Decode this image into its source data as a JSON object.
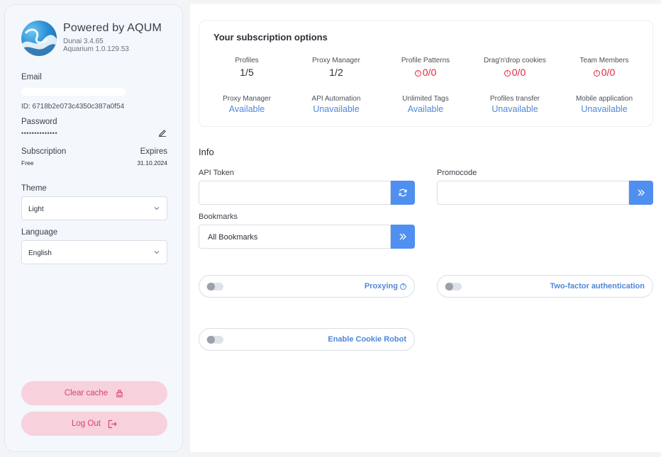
{
  "brand": {
    "powered_by": "Powered by AQUM",
    "version_dunai": "Dunai 3.4.65",
    "version_aquarium": "Aquarium 1.0.129.53"
  },
  "account": {
    "email_label": "Email",
    "id_text": "ID: 6718b2e073c4350c387a0f54",
    "password_label": "Password",
    "password_value": "••••••••••••••",
    "subscription_label": "Subscription",
    "subscription_value": "Free",
    "expires_label": "Expires",
    "expires_value": "31.10.2024",
    "theme_label": "Theme",
    "theme_value": "Light",
    "language_label": "Language",
    "language_value": "English",
    "clear_cache": "Clear cache",
    "log_out": "Log Out"
  },
  "subscription": {
    "title": "Your subscription options",
    "row1": [
      {
        "label": "Profiles",
        "value": "1/5"
      },
      {
        "label": "Proxy Manager",
        "value": "1/2"
      },
      {
        "label": "Profile Patterns",
        "value": "0/0"
      },
      {
        "label": "Drag'n'drop cookies",
        "value": "0/0"
      },
      {
        "label": "Team Members",
        "value": "0/0"
      }
    ],
    "row2": [
      {
        "label": "Proxy Manager",
        "value": "Available"
      },
      {
        "label": "API Automation",
        "value": "Unavailable"
      },
      {
        "label": "Unlimited Tags",
        "value": "Available"
      },
      {
        "label": "Profiles transfer",
        "value": "Unavailable"
      },
      {
        "label": "Mobile application",
        "value": "Unavailable"
      }
    ]
  },
  "info": {
    "title": "Info",
    "api_token_label": "API Token",
    "api_token_value": "",
    "promocode_label": "Promocode",
    "promocode_value": "",
    "bookmarks_label": "Bookmarks",
    "bookmarks_value": "All Bookmarks",
    "proxying_label": "Proxying",
    "two_factor_label": "Two-factor authentication",
    "cookie_robot_label": "Enable Cookie Robot"
  },
  "colors": {
    "accent": "#4f8ff0",
    "link": "#4f87d9",
    "danger": "#e0243f",
    "pink": "#f7d1dc"
  }
}
